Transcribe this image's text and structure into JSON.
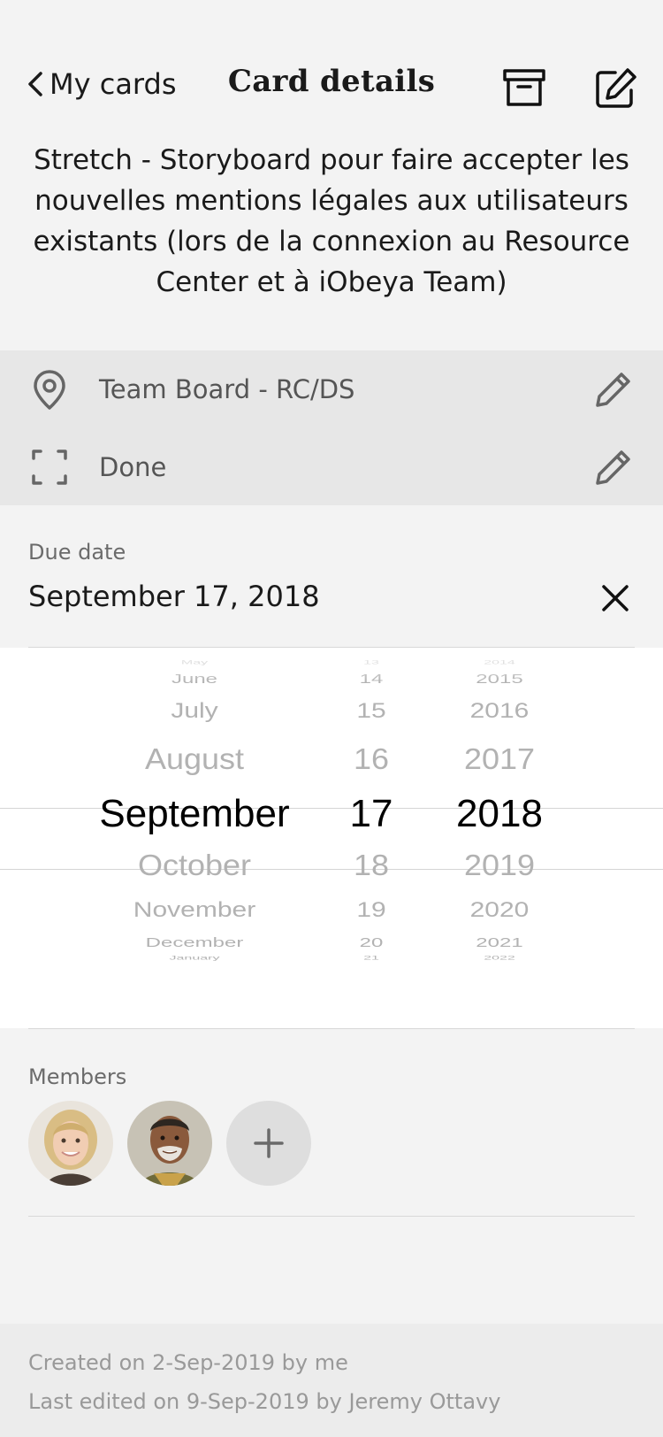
{
  "nav": {
    "back_label": "My cards",
    "title": "Card details",
    "archive_icon": "archive-box-icon",
    "edit_icon": "edit-square-icon"
  },
  "card": {
    "title": "Stretch - Storyboard pour faire accepter les nouvelles mentions légales aux utilisateurs existants (lors de la connexion au Resource Center et à iObeya Team)"
  },
  "info": {
    "board": {
      "icon": "location-pin-icon",
      "value": "Team Board - RC/DS"
    },
    "status": {
      "icon": "frame-icon",
      "value": "Done"
    }
  },
  "due": {
    "label": "Due date",
    "value": "September 17, 2018"
  },
  "picker": {
    "months": [
      "May",
      "June",
      "July",
      "August",
      "September",
      "October",
      "November",
      "December",
      "January"
    ],
    "days": [
      "13",
      "14",
      "15",
      "16",
      "17",
      "18",
      "19",
      "20",
      "21"
    ],
    "years": [
      "2014",
      "2015",
      "2016",
      "2017",
      "2018",
      "2019",
      "2020",
      "2021",
      "2022"
    ],
    "selected_index": 4
  },
  "members": {
    "label": "Members",
    "add_icon": "plus-icon"
  },
  "footer": {
    "created": "Created on 2-Sep-2019 by me",
    "edited": "Last edited on 9-Sep-2019 by Jeremy Ottavy"
  },
  "colors": {
    "background": "#f3f3f3",
    "info_band": "#e7e7e7",
    "picker_bg": "#ffffff",
    "muted_text": "#6b6b6b"
  }
}
